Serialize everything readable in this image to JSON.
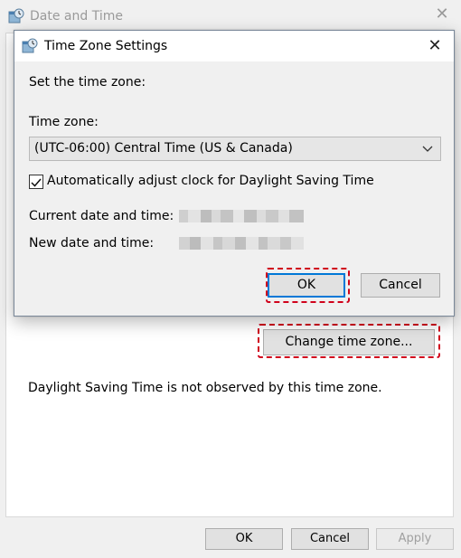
{
  "parent_window": {
    "title": "Date and Time",
    "close_glyph": "✕",
    "change_time_zone_label": "Change time zone...",
    "dst_message": "Daylight Saving Time is not observed by this time zone.",
    "ok_label": "OK",
    "cancel_label": "Cancel",
    "apply_label": "Apply"
  },
  "dialog": {
    "title": "Time Zone Settings",
    "close_glyph": "✕",
    "set_time_zone_label": "Set the time zone:",
    "time_zone_label": "Time zone:",
    "time_zone_value": "(UTC-06:00) Central Time (US & Canada)",
    "dst_checkbox_label": "Automatically adjust clock for Daylight Saving Time",
    "dst_checkbox_checked": true,
    "current_datetime_label": "Current date and time:",
    "new_datetime_label": "New date and time:",
    "ok_label": "OK",
    "cancel_label": "Cancel"
  },
  "icons": {
    "window_icon": "date-time-icon",
    "dropdown": "chevron-down-icon",
    "checkmark": "checkmark-icon"
  },
  "colors": {
    "highlight": "#d0021b",
    "default_button_border": "#0078d7"
  }
}
